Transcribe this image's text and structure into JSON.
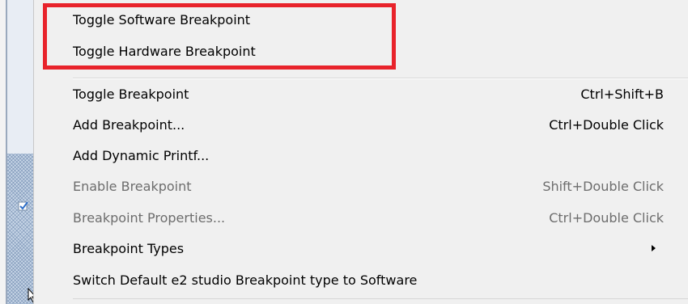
{
  "menu": {
    "items": [
      {
        "label": "Toggle Software Breakpoint",
        "shortcut": "",
        "enabled": true
      },
      {
        "label": "Toggle Hardware Breakpoint",
        "shortcut": "",
        "enabled": true
      },
      {
        "label": "Toggle Breakpoint",
        "shortcut": "Ctrl+Shift+B",
        "enabled": true
      },
      {
        "label": "Add Breakpoint...",
        "shortcut": "Ctrl+Double Click",
        "enabled": true
      },
      {
        "label": "Add Dynamic Printf...",
        "shortcut": "",
        "enabled": true
      },
      {
        "label": "Enable Breakpoint",
        "shortcut": "Shift+Double Click",
        "enabled": false
      },
      {
        "label": "Breakpoint Properties...",
        "shortcut": "Ctrl+Double Click",
        "enabled": false
      },
      {
        "label": "Breakpoint Types",
        "shortcut": "",
        "enabled": true,
        "submenu": true
      },
      {
        "label": "Switch Default e2 studio Breakpoint type to Software",
        "shortcut": "",
        "enabled": true
      }
    ]
  },
  "colors": {
    "highlight_border": "#e8232b",
    "menu_background": "#f0f0f0",
    "disabled_text": "#6d6d6d"
  },
  "icons": {
    "gutter_marker": "checkbox-icon",
    "submenu": "chevron-right-icon",
    "cursor": "mouse-pointer-icon"
  }
}
